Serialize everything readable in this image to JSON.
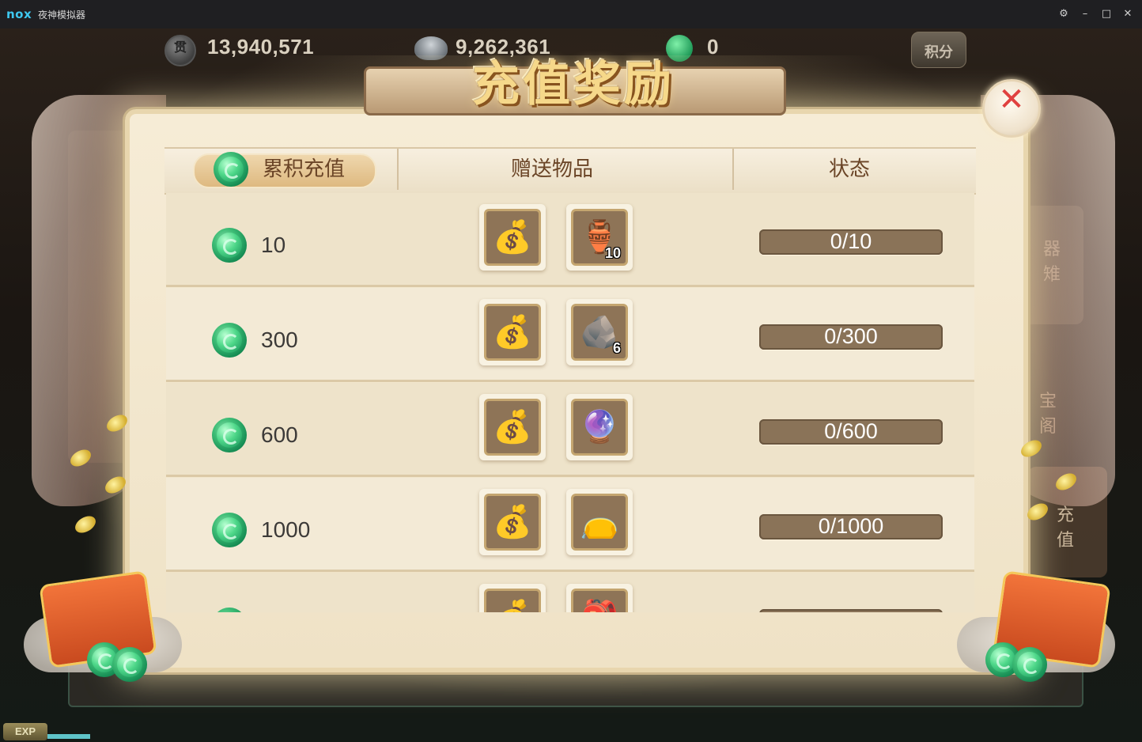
{
  "window": {
    "brand": "nox",
    "title": "夜神模拟器",
    "controls": [
      "⚙",
      "–",
      "□",
      "✕"
    ]
  },
  "currency": {
    "copper": "13,940,571",
    "copper_icon_glyph": "贯",
    "silver": "9,262,361",
    "jade": "0",
    "points_label": "积分"
  },
  "background_labels": {
    "right_upper": "器\n雉",
    "right_mid": "宝\n阁",
    "right_lower": "充\n值"
  },
  "dialog": {
    "title": "充值奖励",
    "close_glyph": "✕",
    "columns": {
      "cumulative": "累积充值",
      "gifts": "赠送物品",
      "status": "状态"
    },
    "rows": [
      {
        "amount": "10",
        "items": [
          {
            "icon": "silver-pouch-icon",
            "glyph": "💰",
            "count": ""
          },
          {
            "icon": "vase-icon",
            "glyph": "🏺",
            "count": "10"
          }
        ],
        "status": "0/10",
        "progress": 0
      },
      {
        "amount": "300",
        "items": [
          {
            "icon": "silver-pouch-icon",
            "glyph": "💰",
            "count": ""
          },
          {
            "icon": "ore-icon",
            "glyph": "🪨",
            "count": "6"
          }
        ],
        "status": "0/300",
        "progress": 0
      },
      {
        "amount": "600",
        "items": [
          {
            "icon": "silver-pouch-icon",
            "glyph": "💰",
            "count": ""
          },
          {
            "icon": "crystal-ball-icon",
            "glyph": "🔮",
            "count": ""
          }
        ],
        "status": "0/600",
        "progress": 0
      },
      {
        "amount": "1000",
        "items": [
          {
            "icon": "silver-pouch-icon",
            "glyph": "💰",
            "count": ""
          },
          {
            "icon": "gold-pouch-icon",
            "glyph": "👝",
            "count": ""
          }
        ],
        "status": "0/1000",
        "progress": 0
      },
      {
        "amount": "",
        "items": [
          {
            "icon": "silver-pouch-icon",
            "glyph": "💰",
            "count": ""
          },
          {
            "icon": "red-pouch-icon",
            "glyph": "🎒",
            "count": ""
          }
        ],
        "status": "",
        "progress": 0
      }
    ]
  },
  "hud": {
    "exp_label": "EXP"
  },
  "colors": {
    "accent_gold": "#f6d88a",
    "close_red": "#e0413f",
    "jade_green": "#2fbf74",
    "progress_track": "#8a7358"
  }
}
